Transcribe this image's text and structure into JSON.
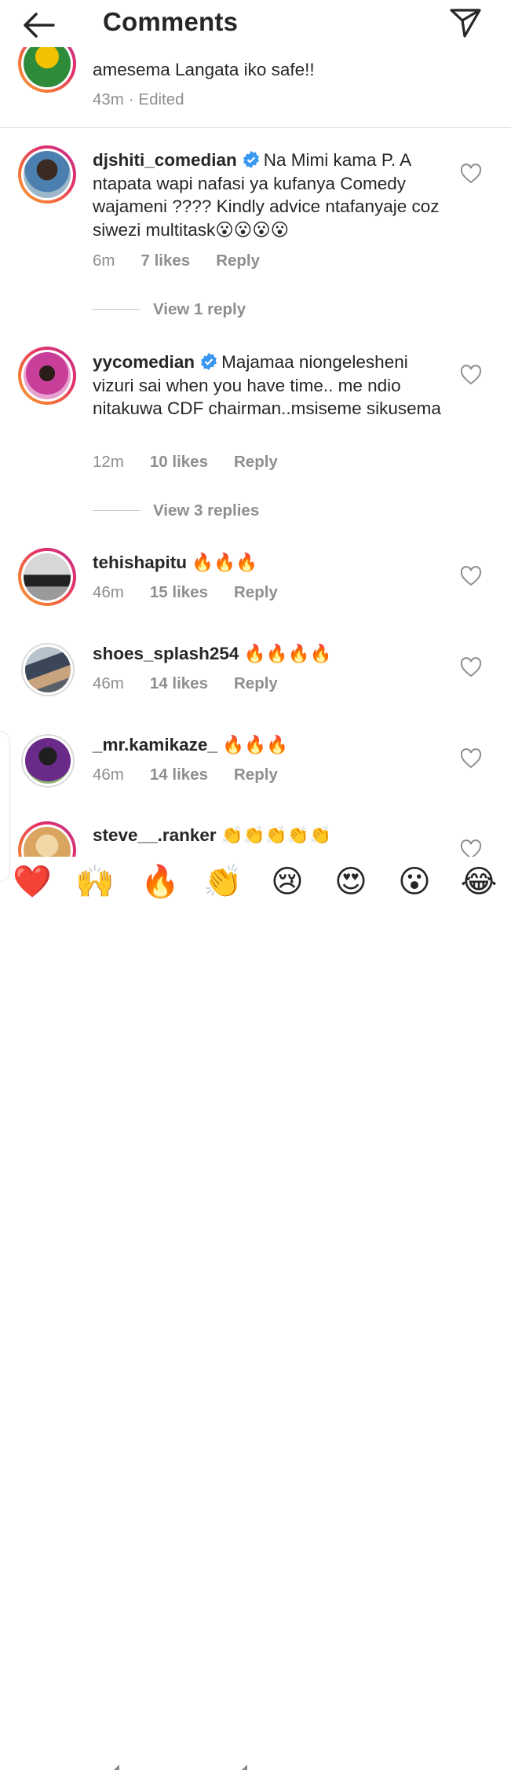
{
  "header": {
    "title": "Comments"
  },
  "top_comment": {
    "text": "amesema Langata iko safe!!",
    "time": "43m",
    "edited": "· Edited"
  },
  "comments": [
    {
      "username": "djshiti_comedian",
      "verified": true,
      "text": "Na Mimi kama P. A ntapata wapi nafasi ya kufanya Comedy wajameni ???? Kindly advice  ntafanyaje coz siwezi multitask😮😮😮😮",
      "time": "6m",
      "likes": "7 likes",
      "reply": "Reply",
      "view_replies": "View 1 reply"
    },
    {
      "username": "yycomedian",
      "verified": true,
      "text": "Majamaa niongelesheni vizuri sai when you have time.. me ndio nitakuwa CDF chairman..msiseme sikusema",
      "time": "12m",
      "likes": "10 likes",
      "reply": "Reply",
      "view_replies": "View 3 replies"
    },
    {
      "username": "tehishapitu",
      "text": "🔥🔥🔥",
      "time": "46m",
      "likes": "15 likes",
      "reply": "Reply"
    },
    {
      "username": "shoes_splash254",
      "text": "🔥🔥🔥🔥",
      "time": "46m",
      "likes": "14 likes",
      "reply": "Reply"
    },
    {
      "username": "_mr.kamikaze_",
      "text": "🔥🔥🔥",
      "time": "46m",
      "likes": "14 likes",
      "reply": "Reply"
    },
    {
      "username": "steve__.ranker",
      "text": "👏👏👏👏👏"
    }
  ],
  "emoji_bar": [
    "❤️",
    "🙌",
    "🔥",
    "👏",
    "😢",
    "😍",
    "😮",
    "😂"
  ],
  "colors": {
    "text": "#262626",
    "meta": "#8e8e8e",
    "verified": "#3897f0",
    "heart": "#ed4956"
  }
}
